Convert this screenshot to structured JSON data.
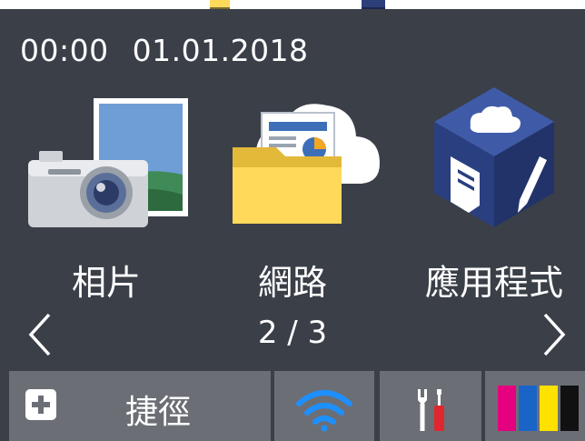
{
  "status": {
    "time": "00:00",
    "date": "01.01.2018"
  },
  "apps": [
    {
      "label": "相片",
      "icon": "photo-camera-icon"
    },
    {
      "label": "網路",
      "icon": "web-folder-icon"
    },
    {
      "label": "應用程式",
      "icon": "apps-cube-icon"
    }
  ],
  "pager": {
    "indicator": "2 / 3",
    "prev_icon": "chevron-left-icon",
    "next_icon": "chevron-right-icon"
  },
  "bottom_bar": {
    "shortcut_label": "捷徑",
    "shortcut_icon": "plus-icon",
    "wifi_icon": "wifi-icon",
    "tools_icon": "tools-icon",
    "ink_icon": "ink-level-icon"
  },
  "colors": {
    "background": "#3a3f48",
    "tile": "#6b6f75",
    "accent_blue": "#1e8fff",
    "ink_magenta": "#e4007f",
    "ink_cyan": "#1a64c8",
    "ink_yellow": "#ffe100",
    "ink_black": "#111111"
  }
}
